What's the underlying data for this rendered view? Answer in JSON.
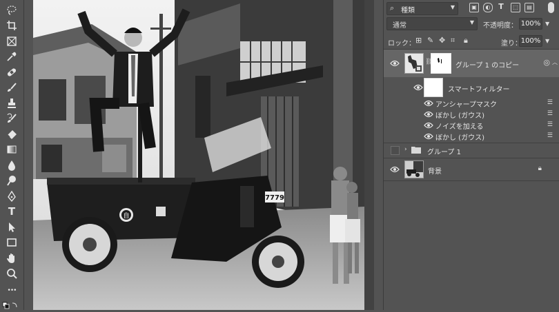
{
  "toolbar": {
    "tools": [
      {
        "icon": "lasso-icon"
      },
      {
        "icon": "crop-icon"
      },
      {
        "icon": "frame-icon"
      },
      {
        "icon": "eyedropper-icon"
      },
      {
        "icon": "healing-brush-icon"
      },
      {
        "icon": "brush-icon"
      },
      {
        "icon": "clone-stamp-icon"
      },
      {
        "icon": "history-brush-icon"
      },
      {
        "icon": "eraser-icon"
      },
      {
        "icon": "gradient-icon"
      },
      {
        "icon": "blur-icon"
      },
      {
        "icon": "dodge-icon"
      },
      {
        "icon": "pen-icon"
      },
      {
        "icon": "type-icon"
      },
      {
        "icon": "path-selection-icon"
      },
      {
        "icon": "rectangle-icon"
      },
      {
        "icon": "hand-icon"
      },
      {
        "icon": "zoom-icon"
      },
      {
        "icon": "more-tools-icon"
      }
    ],
    "type_glyph": "T",
    "more_glyph": "•••"
  },
  "canvas": {
    "plate_text": "7779",
    "emblem_text": "自"
  },
  "layers_panel": {
    "filter_kind": "種類",
    "blend_mode": "通常",
    "opacity_label": "不透明度：",
    "opacity_value": "100%",
    "lock_label": "ロック：",
    "fill_label": "塗り：",
    "fill_value": "100%",
    "layers": [
      {
        "name": "グループ 1 のコピー",
        "visible": true,
        "selected": true
      },
      {
        "name": "スマートフィルター",
        "visible": true
      },
      {
        "name": "アンシャープマスク",
        "visible": true
      },
      {
        "name": "ぼかし (ガウス)",
        "visible": true
      },
      {
        "name": "ノイズを加える",
        "visible": true
      },
      {
        "name": "ぼかし (ガウス)",
        "visible": true
      },
      {
        "name": "グループ 1",
        "visible": false
      },
      {
        "name": "背景",
        "visible": true
      }
    ],
    "colors": {
      "panel_bg": "#535353",
      "selected_row": "#666666",
      "text": "#e6e6e6"
    }
  }
}
